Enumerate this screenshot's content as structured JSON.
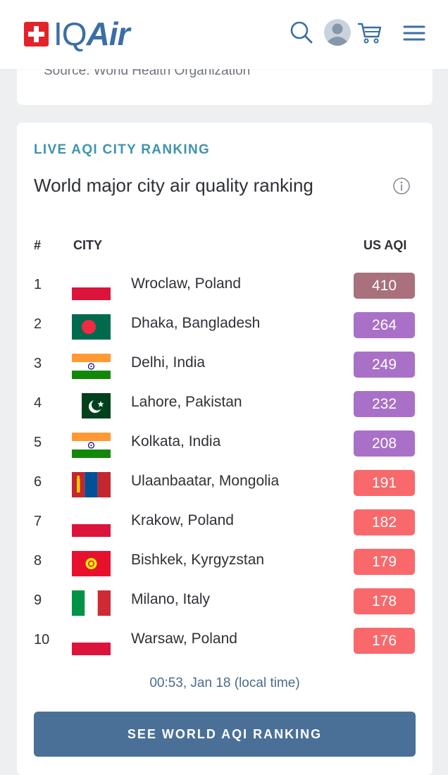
{
  "brand": {
    "name_part1": "IQ",
    "name_part2": "Air"
  },
  "header_icons": [
    "search-icon",
    "user-avatar-icon",
    "cart-icon",
    "menu-icon"
  ],
  "source_note": "Source: World Health Organization",
  "ranking": {
    "eyebrow": "LIVE AQI CITY RANKING",
    "title": "World major city air quality ranking",
    "columns": {
      "rank": "#",
      "city": "CITY",
      "aqi": "US AQI"
    },
    "rows": [
      {
        "rank": "1",
        "flag": "poland",
        "city": "Wroclaw, Poland",
        "aqi": "410",
        "color": "#a8717c"
      },
      {
        "rank": "2",
        "flag": "bangladesh",
        "city": "Dhaka, Bangladesh",
        "aqi": "264",
        "color": "#a970c8"
      },
      {
        "rank": "3",
        "flag": "india",
        "city": "Delhi, India",
        "aqi": "249",
        "color": "#a970c8"
      },
      {
        "rank": "4",
        "flag": "pakistan",
        "city": "Lahore, Pakistan",
        "aqi": "232",
        "color": "#a970c8"
      },
      {
        "rank": "5",
        "flag": "india",
        "city": "Kolkata, India",
        "aqi": "208",
        "color": "#a970c8"
      },
      {
        "rank": "6",
        "flag": "mongolia",
        "city": "Ulaanbaatar, Mongolia",
        "aqi": "191",
        "color": "#f9696b"
      },
      {
        "rank": "7",
        "flag": "poland",
        "city": "Krakow, Poland",
        "aqi": "182",
        "color": "#f9696b"
      },
      {
        "rank": "8",
        "flag": "kyrgyzstan",
        "city": "Bishkek, Kyrgyzstan",
        "aqi": "179",
        "color": "#f9696b"
      },
      {
        "rank": "9",
        "flag": "italy",
        "city": "Milano, Italy",
        "aqi": "178",
        "color": "#f9696b"
      },
      {
        "rank": "10",
        "flag": "poland",
        "city": "Warsaw, Poland",
        "aqi": "176",
        "color": "#f9696b"
      }
    ],
    "timestamp": "00:53, Jan 18 (local time)",
    "cta_label": "SEE WORLD AQI RANKING"
  }
}
